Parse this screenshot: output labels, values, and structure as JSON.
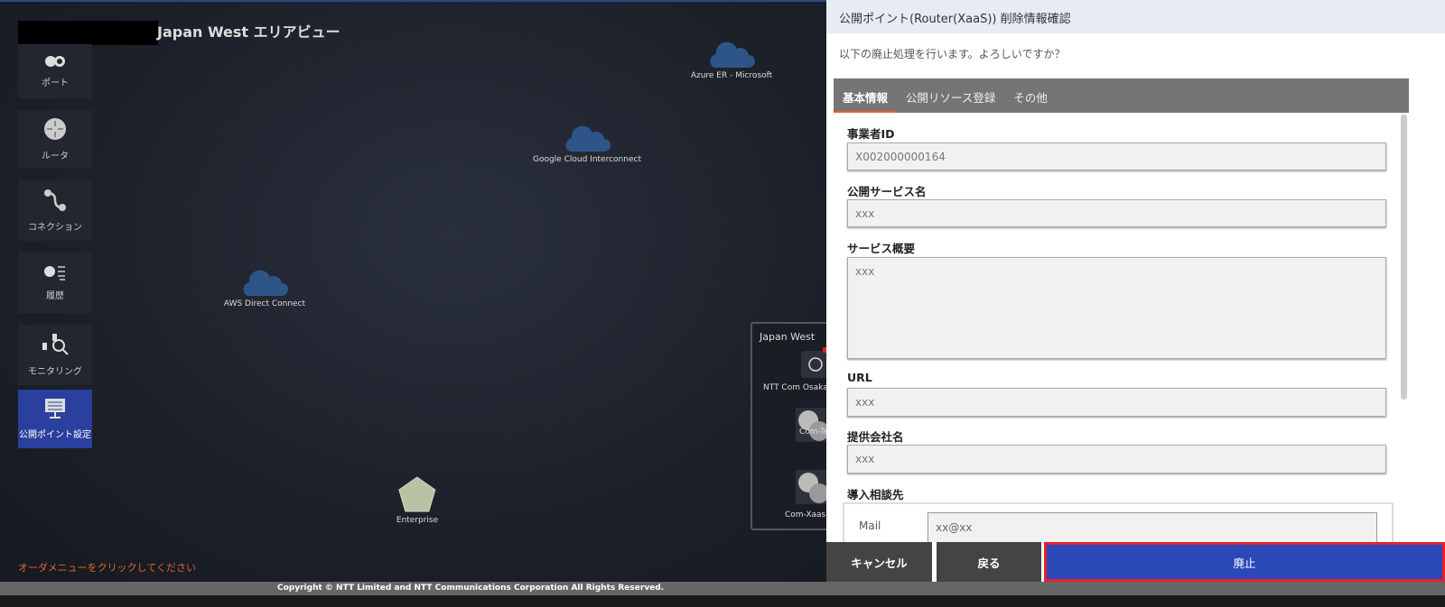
{
  "map": {
    "area_title": "Japan West エリアビュー",
    "hint": "オーダメニューをクリックしてください",
    "sidebar": [
      {
        "label": "ポート",
        "icon": "port-icon"
      },
      {
        "label": "ルータ",
        "icon": "router-icon"
      },
      {
        "label": "コネクション",
        "icon": "connection-icon"
      },
      {
        "label": "履歴",
        "icon": "history-icon"
      },
      {
        "label": "モニタリング",
        "icon": "monitoring-icon"
      },
      {
        "label": "公開ポイント設定",
        "icon": "public-point-icon",
        "active": true
      }
    ],
    "clouds": [
      "Azure ER - Microsoft",
      "Google Cloud Interconnect",
      "AWS Direct Connect"
    ],
    "enterprise": "Enterprise",
    "region": {
      "title": "Japan West",
      "nodes": [
        "NTT Com Osaka(",
        "Com-Te",
        "Com-XaasR"
      ]
    }
  },
  "dialog": {
    "title": "公開ポイント(Router(XaaS)) 削除情報確認",
    "message": "以下の廃止処理を行います。よろしいですか？",
    "tabs": [
      "基本情報",
      "公開リソース登録",
      "その他"
    ],
    "fields": [
      {
        "label": "事業者ID",
        "value": "X002000000164"
      },
      {
        "label": "公開サービス名",
        "value": "xxx"
      },
      {
        "label": "サービス概要",
        "value": "xxx"
      },
      {
        "label": "URL",
        "value": "xxx"
      },
      {
        "label": "提供会社名",
        "value": "xxx"
      }
    ],
    "contact": {
      "label": "導入相談先",
      "mail_label": "Mail",
      "mail_value": "xx@xx"
    },
    "buttons": {
      "cancel": "キャンセル",
      "back": "戻る",
      "abolish": "廃止"
    }
  },
  "footer": "Copyright © NTT Limited and NTT Communications Corporation All Rights Reserved.",
  "colors": {
    "accent": "#2a48b8",
    "highlight": "#e8202a",
    "tab_underline": "#e8602c"
  }
}
